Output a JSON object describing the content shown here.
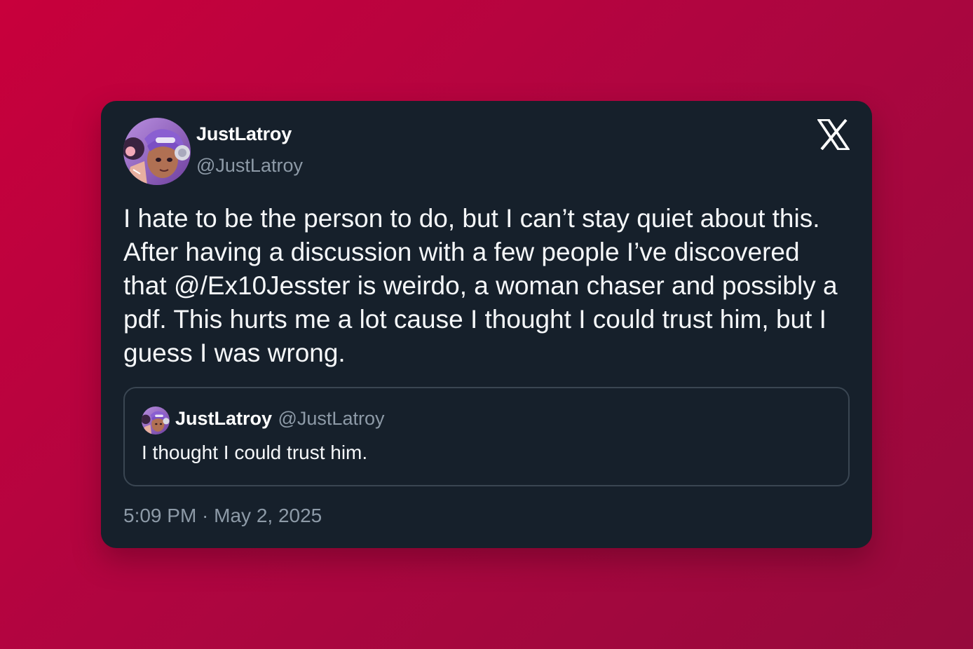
{
  "tweet": {
    "author": {
      "name": "JustLatroy",
      "handle": "@JustLatroy"
    },
    "text": "I hate to be the person to do, but I can’t stay quiet about this. After having a discussion with a few people I’ve discovered that @/Ex10Jesster is weirdo, a woman chaser and possibly a pdf. This hurts me a lot cause I thought I could trust him, but I guess I was wrong.",
    "quoted": {
      "name": "JustLatroy",
      "handle": "@JustLatroy",
      "text": "I thought I could trust him."
    },
    "timestamp": "5:09 PM · May 2, 2025"
  },
  "icons": {
    "brand": "x-logo-icon",
    "avatar": "avatar-image"
  },
  "colors": {
    "background_start": "#c8003c",
    "background_end": "#960a3c",
    "card": "#16202b",
    "text_primary": "#f5f7f9",
    "text_secondary": "#8d9aa7",
    "quote_border": "#3a4652"
  }
}
